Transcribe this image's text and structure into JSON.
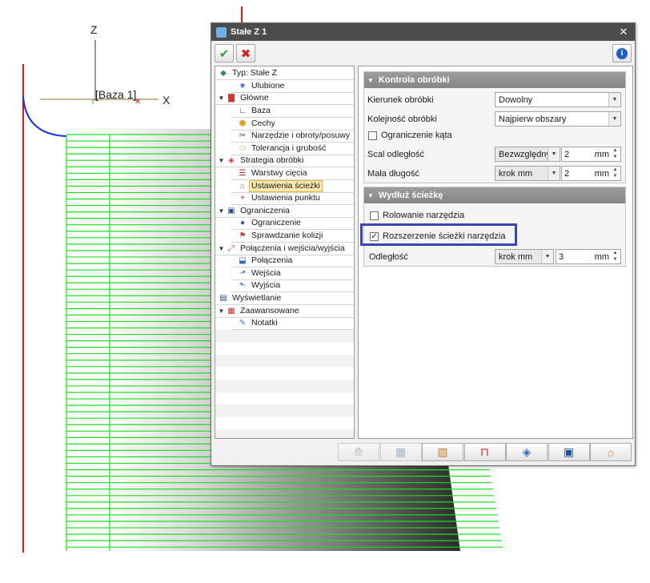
{
  "viewport": {
    "axis_z": "Z",
    "axis_x": "X",
    "base_label": "[Baza 1]"
  },
  "dialog": {
    "title": "Stałe Z 1",
    "close": "✕",
    "ok_icon": "checkmark-icon",
    "cancel_icon": "cross-icon",
    "info_icon": "info-icon"
  },
  "tree": {
    "items": [
      {
        "label": "Typ: Stałe Z",
        "icon": "type-icon"
      },
      {
        "label": "Ulubione",
        "icon": "star-icon"
      },
      {
        "label": "Główne",
        "icon": "main-icon"
      },
      {
        "label": "Baza",
        "icon": "axis-icon"
      },
      {
        "label": "Cechy",
        "icon": "features-icon"
      },
      {
        "label": "Narzędzie i obroty/posuwy",
        "icon": "tool-icon"
      },
      {
        "label": "Tolerancja i grubość",
        "icon": "tolerance-icon"
      },
      {
        "label": "Strategia obróbki",
        "icon": "strategy-icon"
      },
      {
        "label": "Warstwy cięcia",
        "icon": "layers-icon"
      },
      {
        "label": "Ustawienia ścieżki",
        "icon": "path-settings-icon"
      },
      {
        "label": "Ustawienia punktu",
        "icon": "point-icon"
      },
      {
        "label": "Ograniczenia",
        "icon": "limits-icon"
      },
      {
        "label": "Ograniczenie",
        "icon": "limit-icon"
      },
      {
        "label": "Sprawdzanie kolizji",
        "icon": "collision-icon"
      },
      {
        "label": "Połączenia i wejścia/wyjścia",
        "icon": "connections-icon"
      },
      {
        "label": "Połączenia",
        "icon": "link-icon"
      },
      {
        "label": "Wejścia",
        "icon": "entry-icon"
      },
      {
        "label": "Wyjścia",
        "icon": "exit-icon"
      },
      {
        "label": "Wyświetlanie",
        "icon": "display-icon"
      },
      {
        "label": "Zaawansowane",
        "icon": "advanced-icon"
      },
      {
        "label": "Notatki",
        "icon": "notes-icon"
      }
    ]
  },
  "kontrola": {
    "title": "Kontrola obróbki",
    "kierunek_label": "Kierunek obróbki",
    "kierunek_value": "Dowolny",
    "kolejnosc_label": "Kolejność obróbki",
    "kolejnosc_value": "Najpierw obszary",
    "ograniczenie_label": "Ograniczenie kąta",
    "scal_label": "Scal odległość",
    "scal_mode": "Bezwzględny",
    "scal_value": "2",
    "scal_unit": "mm",
    "mala_label": "Mała długość",
    "mala_mode": "krok mm",
    "mala_value": "2",
    "mala_unit": "mm"
  },
  "wydluz": {
    "title": "Wydłuż ścieżkę",
    "rolowanie_label": "Rolowanie narzędzia",
    "rozszerzenie_label": "Rozszerzenie ścieżki narzędzia",
    "odleglosc_label": "Odległość",
    "odleglosc_mode": "krok mm",
    "odleglosc_value": "3",
    "odleglosc_unit": "mm"
  },
  "bottom_buttons": [
    "calculate-icon",
    "calculator-icon",
    "edit-icon",
    "path-icon",
    "simulate-icon",
    "save-icon",
    "home-icon"
  ]
}
